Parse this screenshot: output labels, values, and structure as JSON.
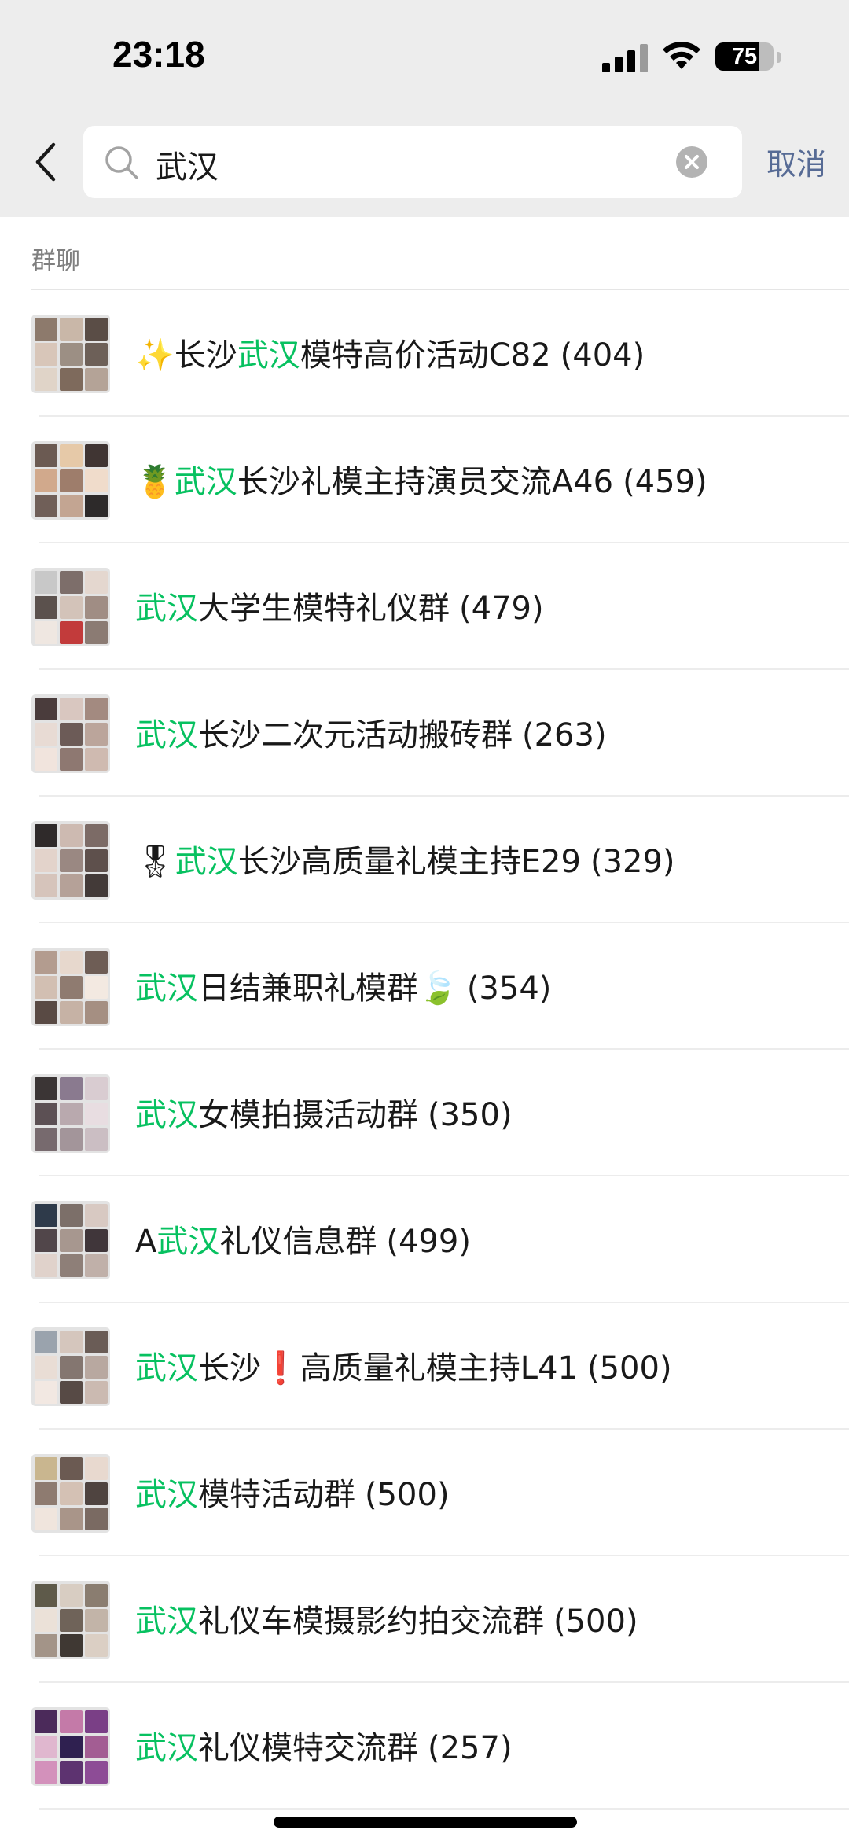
{
  "status_bar": {
    "time": "23:18",
    "battery": "75",
    "battery_level": 0.75
  },
  "search": {
    "value": "武汉",
    "cancel_label": "取消"
  },
  "section": {
    "header": "群聊"
  },
  "highlight_color": "#07c160",
  "groups": [
    {
      "icon": "✨",
      "before": "长沙",
      "match": "武汉",
      "after": "模特高价活动C82",
      "count": "(404)"
    },
    {
      "icon": "🍍",
      "before": "",
      "match": "武汉",
      "after": "长沙礼模主持演员交流A46",
      "count": "(459)"
    },
    {
      "icon": "",
      "before": "",
      "match": "武汉",
      "after": "大学生模特礼仪群",
      "count": "(479)"
    },
    {
      "icon": "",
      "before": "",
      "match": "武汉",
      "after": "长沙二次元活动搬砖群",
      "count": "(263)"
    },
    {
      "icon": "🎖",
      "before": "",
      "match": "武汉",
      "after": "长沙高质量礼模主持E29",
      "count": "(329)"
    },
    {
      "icon": "",
      "before": "",
      "match": "武汉",
      "after": "日结兼职礼模群🍃",
      "count": "(354)"
    },
    {
      "icon": "",
      "before": "",
      "match": "武汉",
      "after": "女模拍摄活动群",
      "count": "(350)"
    },
    {
      "icon": "",
      "before": "A",
      "match": "武汉",
      "after": "礼仪信息群",
      "count": "(499)"
    },
    {
      "icon": "",
      "before": "",
      "match": "武汉",
      "after": "长沙❗高质量礼模主持L41",
      "count": "(500)"
    },
    {
      "icon": "",
      "before": "",
      "match": "武汉",
      "after": "模特活动群",
      "count": "(500)"
    },
    {
      "icon": "",
      "before": "",
      "match": "武汉",
      "after": "礼仪车模摄影约拍交流群",
      "count": "(500)"
    },
    {
      "icon": "",
      "before": "",
      "match": "武汉",
      "after": "礼仪模特交流群",
      "count": "(257)"
    }
  ]
}
